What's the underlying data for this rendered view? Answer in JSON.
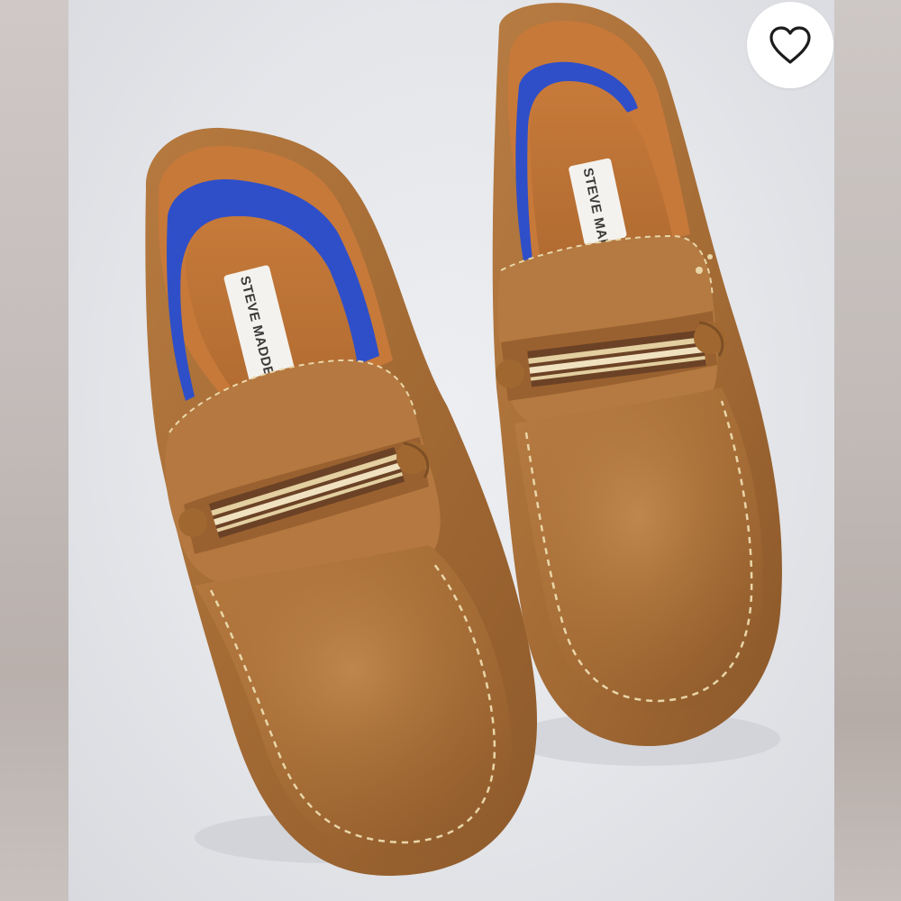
{
  "product_image": {
    "brand_label": "STEVE MADDEN",
    "alt": "Steve Madden tan leather driving loafers"
  },
  "favorite": {
    "icon": "heart-outline-icon",
    "selected": false
  },
  "colors": {
    "leather": "#a8703a",
    "insole_lining": "#2f4fc8",
    "stitching": "#e9d6a8",
    "background": "#e6e8ec"
  }
}
